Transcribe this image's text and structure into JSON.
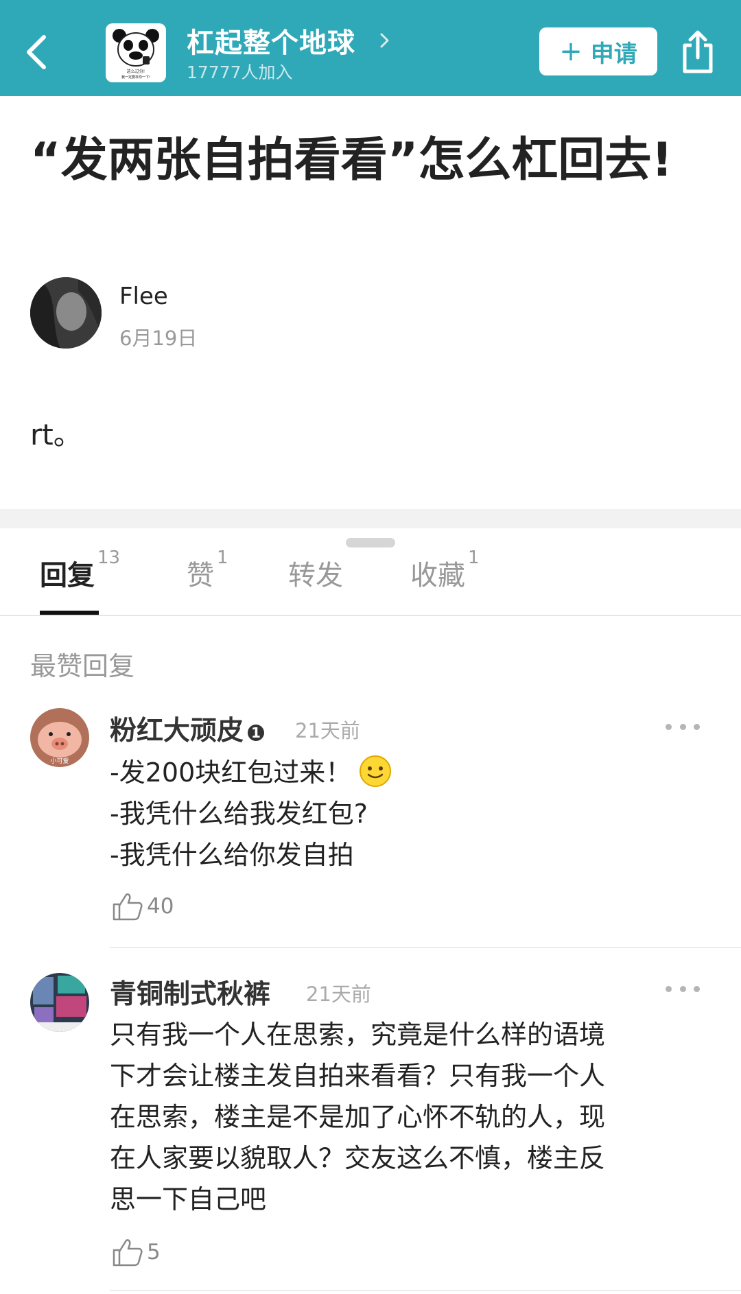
{
  "topbar": {
    "group_name": "杠起整个地球",
    "member_count": "17777人加入",
    "apply_label": "申请",
    "logo_caption_1": "这么过分!",
    "logo_caption_2": "我一定要杠你一下!",
    "color": "#2fa8b8"
  },
  "post": {
    "title": "“发两张自拍看看”怎么杠回去!",
    "author": "Flee",
    "date": "6月19日",
    "body": "rt。"
  },
  "tabs": [
    {
      "label": "回复",
      "count": "13",
      "active": true
    },
    {
      "label": "赞",
      "count": "1"
    },
    {
      "label": "转发",
      "count": ""
    },
    {
      "label": "收藏",
      "count": "1"
    }
  ],
  "section_label": "最赞回复",
  "comments": [
    {
      "name": "粉红大顽皮",
      "badge": "1",
      "time": "21天前",
      "lines": [
        "-发200块红包过来！",
        "-我凭什么给我发红包?",
        "-我凭什么给你发自拍"
      ],
      "likes": "40",
      "avatar_caption": "小可爱"
    },
    {
      "name": "青铜制式秋裤",
      "time": "21天前",
      "lines": [
        "只有我一个人在思索，究竟是什么样的语境",
        "下才会让楼主发自拍来看看？只有我一个人",
        "在思索，楼主是不是加了心怀不轨的人，现",
        "在人家要以貌取人？交友这么不慎，楼主反",
        "思一下自己吧"
      ],
      "likes": "5"
    }
  ]
}
